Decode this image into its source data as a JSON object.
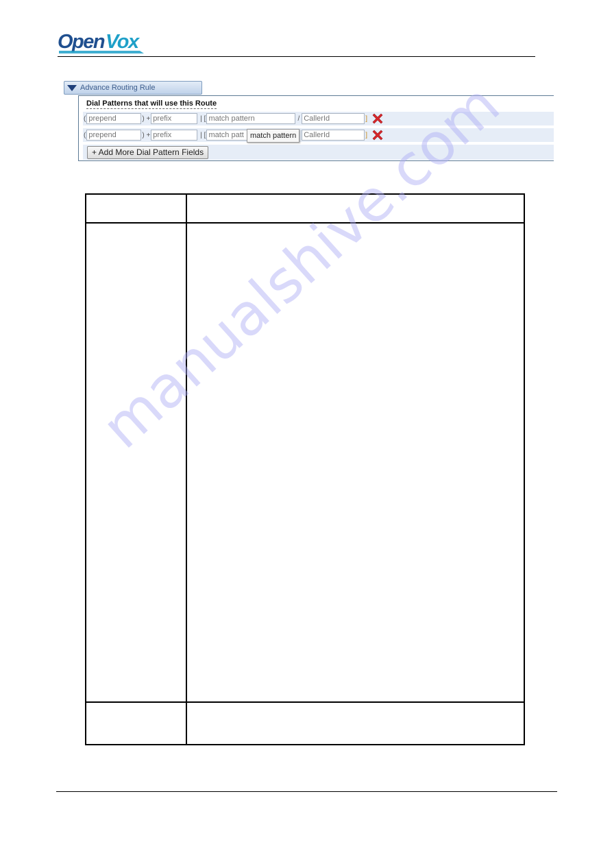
{
  "header": {
    "logo_text": "OpenVox",
    "logo_colors": {
      "primary": "#1f4f8f",
      "accent": "#1fa0c8"
    }
  },
  "panel": {
    "title": "Advance Routing Rule",
    "section_label": "Dial Patterns that will use this Route",
    "rows": [
      {
        "prepend_placeholder": "prepend",
        "prefix_placeholder": "prefix",
        "match_placeholder": "match pattern",
        "callerid_placeholder": "CallerId",
        "delete_icon": "red-x-delete-icon"
      },
      {
        "prepend_placeholder": "prepend",
        "prefix_placeholder": "prefix",
        "match_placeholder": "match patt",
        "callerid_placeholder": "CallerId",
        "delete_icon": "red-x-delete-icon"
      }
    ],
    "separators": {
      "open_paren": "(",
      "close_paren_plus": ") +",
      "pipe_bracket": "| [",
      "slash": "/",
      "close_bracket": "]"
    },
    "tooltip": "match pattern",
    "add_button_label": "+ Add More Dial Pattern Fields",
    "colors": {
      "row_bg": "#e6edf7",
      "border": "#5d7a95",
      "delete": "#d9262b"
    }
  },
  "table": {
    "rows": [
      {
        "col1": "",
        "col2": ""
      },
      {
        "col1": "",
        "col2": ""
      },
      {
        "col1": "",
        "col2": ""
      }
    ]
  },
  "watermark": "manualshive.com"
}
